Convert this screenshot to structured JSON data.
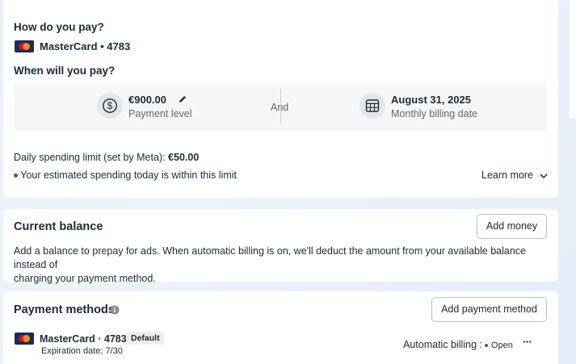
{
  "billing": {
    "how_pay_title": "How do you pay?",
    "card_label": "MasterCard • 4783",
    "when_pay_title": "When will you pay?",
    "payment_level_value": "€900.00",
    "payment_level_label": "Payment level",
    "and_label": "And",
    "billing_date_value": "August 31, 2025",
    "billing_date_label": "Monthly billing date",
    "daily_limit_prefix": "Daily spending limit (set by Meta): ",
    "daily_limit_value": "€50.00",
    "limit_status": "Your estimated spending today is within this limit",
    "learn_more": "Learn more"
  },
  "balance": {
    "title": "Current balance",
    "add_money": "Add money",
    "description_line1": "Add a balance to prepay for ads. When automatic billing is on, we'll deduct the amount from your available balance instead of",
    "description_line2": "charging your payment method."
  },
  "methods": {
    "title": "Payment methods",
    "add_payment_method": "Add payment method",
    "items": [
      {
        "card_label": "MasterCard · 4783",
        "badge": "Default",
        "expiration": "Expiration date: 7/30",
        "auto_billing_label": "Automatic billing : ",
        "auto_billing_status": "Open",
        "more": "···"
      }
    ]
  },
  "colors": {
    "status_green": "#1b7a3e",
    "text_primary": "#1c2b33",
    "text_secondary": "#65676b"
  },
  "icons": [
    "mastercard-icon",
    "pencil-icon",
    "dollar-icon",
    "calendar-icon",
    "chevron-down-icon",
    "info-icon",
    "more-icon"
  ]
}
